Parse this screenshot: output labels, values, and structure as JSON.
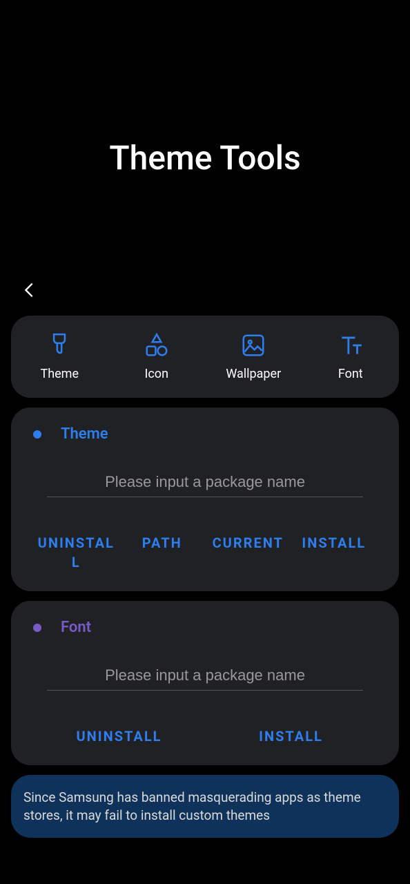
{
  "app": {
    "title": "Theme Tools"
  },
  "nav": {
    "items": [
      {
        "label": "Theme"
      },
      {
        "label": "Icon"
      },
      {
        "label": "Wallpaper"
      },
      {
        "label": "Font"
      }
    ]
  },
  "sections": {
    "theme": {
      "title": "Theme",
      "placeholder": "Please input a package name",
      "buttons": {
        "uninstall": "UNINSTALL",
        "path": "PATH",
        "current": "CURRENT",
        "install": "INSTALL"
      }
    },
    "font": {
      "title": "Font",
      "placeholder": "Please input a package name",
      "buttons": {
        "uninstall": "UNINSTALL",
        "install": "INSTALL"
      }
    }
  },
  "notice": {
    "text": "Since Samsung has banned masquerading apps as theme stores, it may fail to install custom themes"
  },
  "colors": {
    "accent_blue": "#2e7eee",
    "accent_purple": "#7a5ac7",
    "card_bg": "#202124",
    "notice_bg": "#0e3259"
  }
}
